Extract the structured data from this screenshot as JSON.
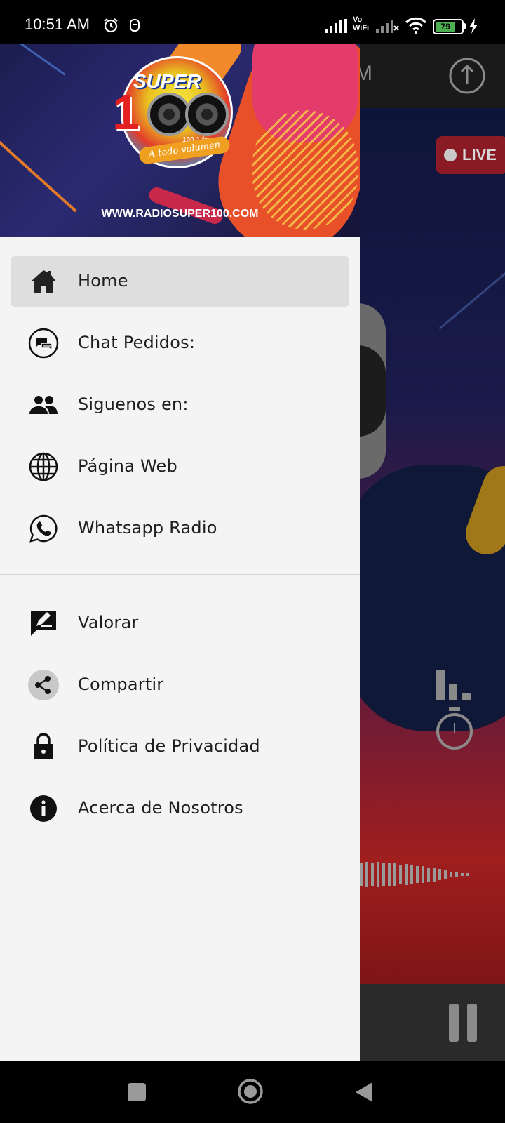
{
  "status_bar": {
    "time": "10:51 AM",
    "vowifi_line1": "Vo",
    "vowifi_line2": "WiFi",
    "battery": "79",
    "icons": [
      "alarm-icon",
      "notification-icon",
      "signal-icon",
      "signal-icon",
      "wifi-icon",
      "battery-icon",
      "charging-icon"
    ]
  },
  "drawer": {
    "header": {
      "logo_text": "SUPER",
      "logo_number": "1",
      "logo_freq": "100.1 fm",
      "logo_slogan": "A todo volumen",
      "url": "WWW.RADIOSUPER100.COM"
    },
    "items": [
      {
        "label": "Home",
        "icon": "home-icon",
        "active": true
      },
      {
        "label": "Chat Pedidos:",
        "icon": "chat-icon"
      },
      {
        "label": "Siguenos en:",
        "icon": "people-icon"
      },
      {
        "label": "Página Web",
        "icon": "globe-icon"
      },
      {
        "label": "Whatsapp Radio",
        "icon": "whatsapp-icon"
      }
    ],
    "secondary_items": [
      {
        "label": "Valorar",
        "icon": "rate-icon"
      },
      {
        "label": "Compartir",
        "icon": "share-icon"
      },
      {
        "label": "Política de Privacidad",
        "icon": "lock-icon"
      },
      {
        "label": "Acerca de Nosotros",
        "icon": "info-icon"
      }
    ]
  },
  "background_app": {
    "live_label": "LIVE",
    "title_fragment": "M"
  },
  "colors": {
    "drawer_bg": "#f4f4f4",
    "active_item_bg": "#dedede",
    "live_badge": "#8a1a24"
  }
}
